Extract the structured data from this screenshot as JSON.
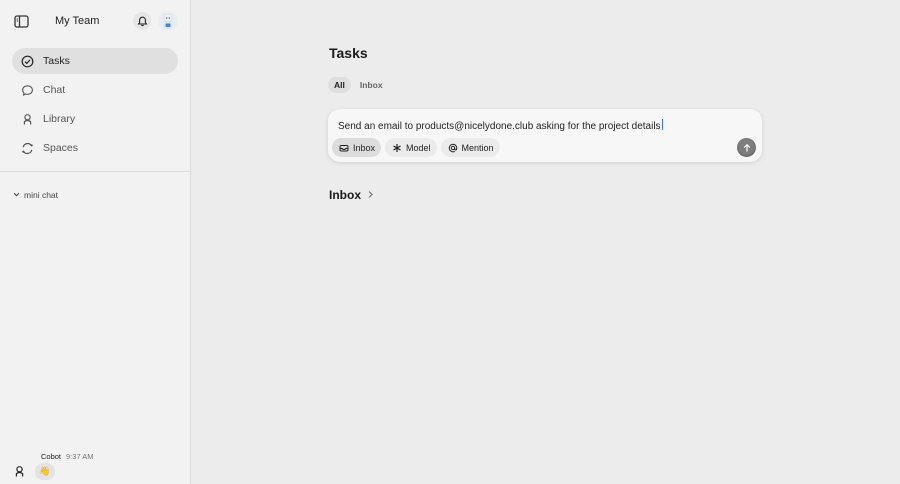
{
  "sidebar": {
    "team_name": "My Team",
    "nav": [
      {
        "label": "Tasks",
        "icon": "check-circle-icon",
        "active": true
      },
      {
        "label": "Chat",
        "icon": "chat-bubble-icon",
        "active": false
      },
      {
        "label": "Library",
        "icon": "library-icon",
        "active": false
      },
      {
        "label": "Spaces",
        "icon": "spaces-icon",
        "active": false
      }
    ],
    "mini_chat_label": "mini chat",
    "last_message": {
      "sender": "Cobot",
      "time": "9:37 AM",
      "emoji": "👋"
    }
  },
  "main": {
    "title": "Tasks",
    "tabs": [
      {
        "label": "All",
        "active": true
      },
      {
        "label": "Inbox",
        "active": false
      }
    ],
    "composer": {
      "value": "Send an email to products@nicelydone.club asking for the project details",
      "chips": [
        {
          "label": "Inbox",
          "icon": "inbox-icon",
          "selected": true
        },
        {
          "label": "Model",
          "icon": "model-icon",
          "selected": false
        },
        {
          "label": "Mention",
          "icon": "at-icon",
          "selected": false
        }
      ]
    },
    "section": {
      "title": "Inbox"
    }
  },
  "colors": {
    "background": "#ececec",
    "sidebar": "#f2f2f2",
    "active_nav": "#e0e0e0",
    "caret": "#3b73d9"
  }
}
